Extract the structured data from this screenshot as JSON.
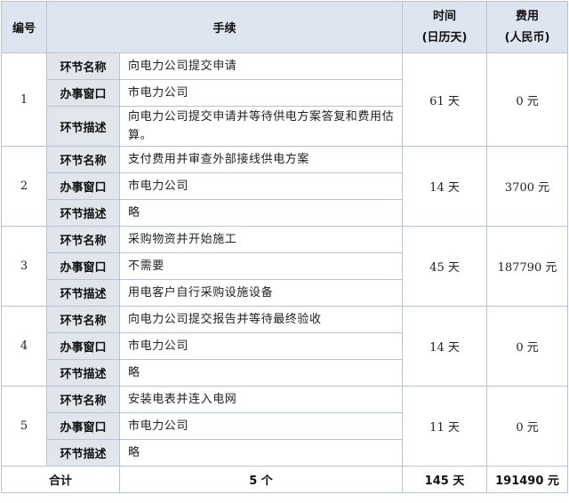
{
  "header": {
    "number": "编号",
    "procedure": "手续",
    "time": "时间",
    "time_unit": "(日历天)",
    "cost": "费用",
    "cost_unit": "(人民币)"
  },
  "labels": {
    "name": "环节名称",
    "window": "办事窗口",
    "desc": "环节描述"
  },
  "steps": [
    {
      "no": "1",
      "name": "向电力公司提交申请",
      "window": "市电力公司",
      "desc": "向电力公司提交申请并等待供电方案答复和费用估算。",
      "time": "61 天",
      "cost": "0 元"
    },
    {
      "no": "2",
      "name": "支付费用并审查外部接线供电方案",
      "window": "市电力公司",
      "desc": "略",
      "time": "14 天",
      "cost": "3700 元"
    },
    {
      "no": "3",
      "name": "采购物资并开始施工",
      "window": "不需要",
      "desc": "用电客户自行采购设施设备",
      "time": "45 天",
      "cost": "187790 元"
    },
    {
      "no": "4",
      "name": "向电力公司提交报告并等待最终验收",
      "window": "市电力公司",
      "desc": "略",
      "time": "14 天",
      "cost": "0 元"
    },
    {
      "no": "5",
      "name": "安装电表并连入电网",
      "window": "市电力公司",
      "desc": "略",
      "time": "11 天",
      "cost": "0 元"
    }
  ],
  "total": {
    "label": "合计",
    "count": "5 个",
    "time": "145 天",
    "cost": "191490 元"
  }
}
